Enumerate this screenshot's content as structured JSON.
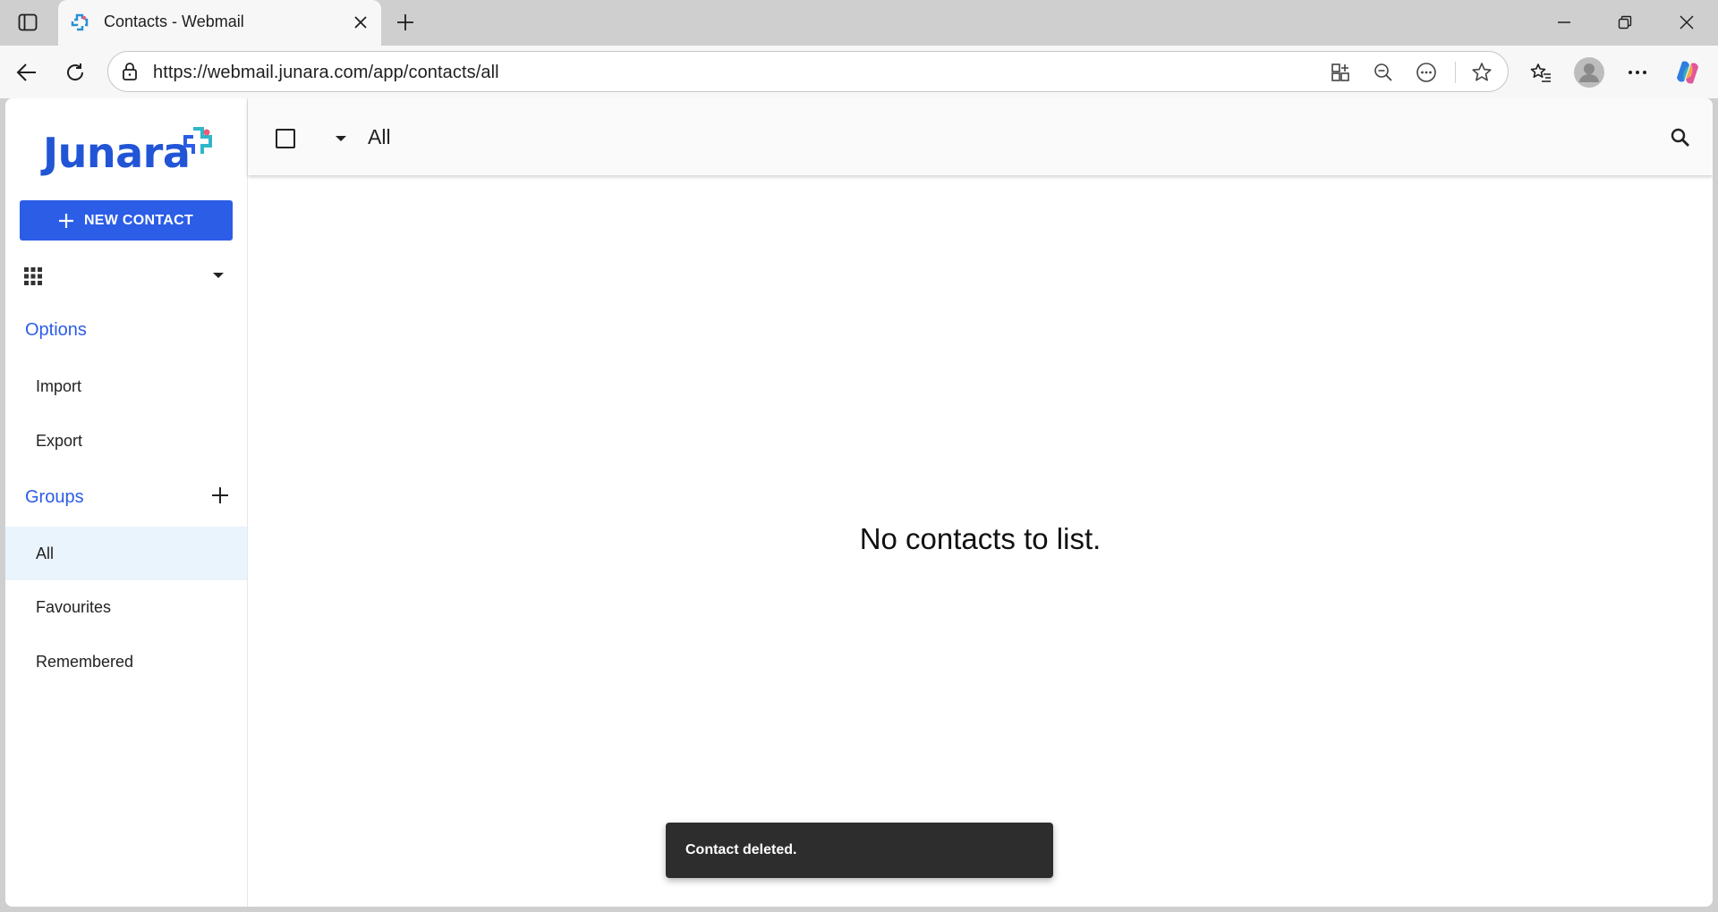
{
  "browser": {
    "tab_title": "Contacts - Webmail",
    "url": "https://webmail.junara.com/app/contacts/all"
  },
  "app": {
    "logo_text": "Junara",
    "brand_color": "#2b5de6",
    "new_contact_label": "NEW CONTACT",
    "sidebar": {
      "options_title": "Options",
      "options_items": [
        "Import",
        "Export"
      ],
      "groups_title": "Groups",
      "groups_items": [
        "All",
        "Favourites",
        "Remembered"
      ],
      "active_group": "All"
    },
    "header": {
      "title": "All"
    },
    "empty_message": "No contacts to list.",
    "snackbar": "Contact deleted."
  },
  "icons": {
    "tab_actions": "tab-actions-icon",
    "favicon": "junara-favicon",
    "close": "close-icon",
    "new_tab": "plus-icon",
    "minimize": "minimize-icon",
    "restore": "restore-icon",
    "window_close": "close-icon",
    "back": "back-arrow-icon",
    "refresh": "refresh-icon",
    "lock": "lock-icon",
    "app_view": "app-view-icon",
    "zoom_out": "zoom-out-icon",
    "more_circle": "more-circle-icon",
    "favorite": "star-icon",
    "favorites_list": "favorites-list-icon",
    "profile": "profile-avatar-icon",
    "more": "more-horizontal-icon",
    "copilot": "copilot-icon",
    "apps": "apps-grid-icon",
    "caret": "caret-down-icon",
    "search": "search-icon"
  }
}
